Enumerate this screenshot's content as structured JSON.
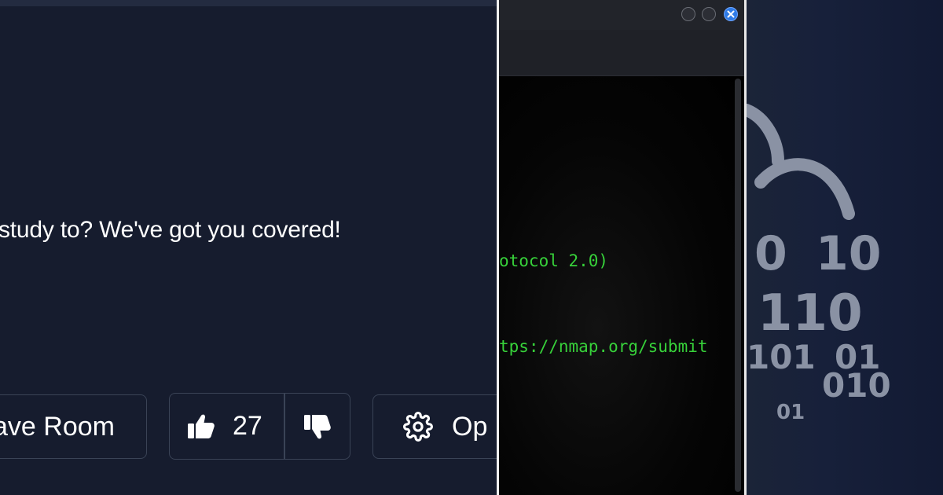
{
  "room": {
    "description": "study to? We've got you covered!",
    "leave_label": "ave Room",
    "upvote_count": "27",
    "options_label": "Op"
  },
  "terminal": {
    "line_protocol": "otocol 2.0)",
    "line_url": "tps://nmap.org/submit"
  },
  "art": {
    "binary": [
      "0",
      "10",
      "110",
      "101",
      "01",
      "010",
      "01"
    ]
  },
  "colors": {
    "page_bg": "#161c2e",
    "button_border": "#3a4356",
    "terminal_text": "#37d13a",
    "close_button": "#2f7be6",
    "binary_text": "#8a92a4"
  },
  "icons": {
    "upvote": "thumbs-up-icon",
    "downvote": "thumbs-down-icon",
    "options": "gear-icon",
    "close": "close-icon"
  }
}
